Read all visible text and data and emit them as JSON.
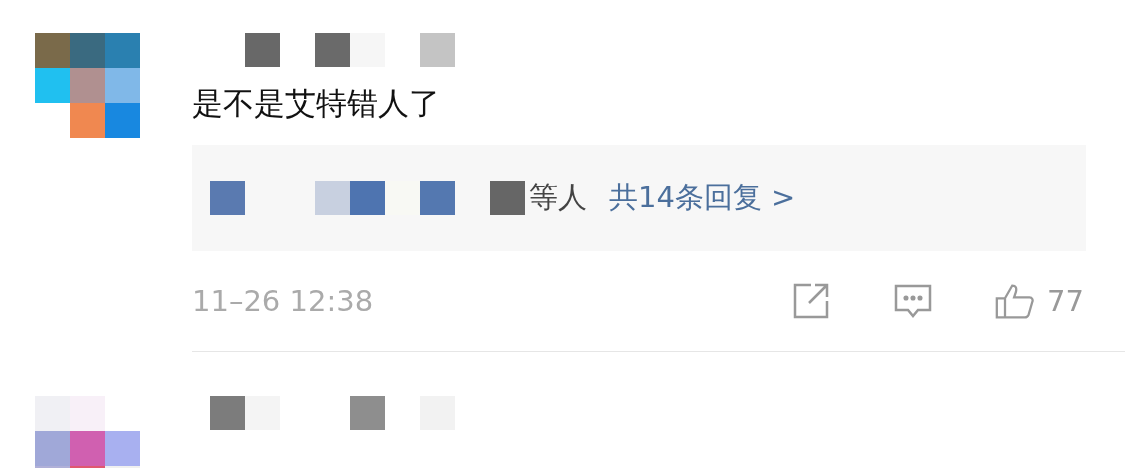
{
  "comments": [
    {
      "kind": "full",
      "text": "是不是艾特错人了",
      "reply_preview": {
        "suffix": "等人",
        "summary": "共14条回复 >"
      },
      "time": "11–26 12:38",
      "likes": "77"
    },
    {
      "kind": "cut"
    }
  ]
}
